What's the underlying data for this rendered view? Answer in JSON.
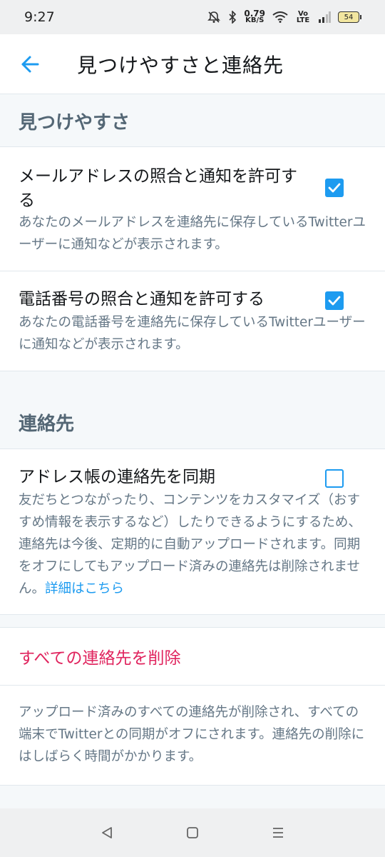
{
  "status_bar": {
    "time": "9:27",
    "net_speed_value": "0.79",
    "net_speed_unit": "KB/S",
    "network_label": "Vo LTE",
    "battery": "54",
    "icons": [
      "mute-icon",
      "bluetooth-icon",
      "wifi-icon",
      "signal-icon",
      "battery-icon"
    ]
  },
  "header": {
    "title": "見つけやすさと連絡先",
    "back_icon": "arrow-left-icon"
  },
  "discoverability": {
    "heading": "見つけやすさ",
    "email_row": {
      "title": "メールアドレスの照合と通知を許可する",
      "description": "あなたのメールアドレスを連絡先に保存しているTwitterユーザーに通知などが表示されます。",
      "checked": true
    },
    "phone_row": {
      "title": "電話番号の照合と通知を許可する",
      "description": "あなたの電話番号を連絡先に保存しているTwitterユーザーに通知などが表示されます。",
      "checked": true
    }
  },
  "contacts": {
    "heading": "連絡先",
    "sync_row": {
      "title": "アドレス帳の連絡先を同期",
      "description": "友だちとつながったり、コンテンツをカスタマイズ（おすすめ情報を表示するなど）したりできるようにするため、連絡先は今後、定期的に自動アップロードされます。同期をオフにしてもアップロード済みの連絡先は削除されません。",
      "link": "詳細はこちら",
      "checked": false
    },
    "delete_label": "すべての連絡先を削除",
    "delete_description": "アップロード済みのすべての連絡先が削除され、すべての端末でTwitterとの同期がオフにされます。連絡先の削除にはしばらく時間がかかります。"
  },
  "nav": {
    "back_icon": "triangle-back-icon",
    "home_icon": "square-home-icon",
    "menu_icon": "menu-lines-icon"
  },
  "colors": {
    "accent": "#1d9bf0",
    "danger": "#e0245e",
    "section_text": "#546775",
    "secondary_text": "#657786",
    "background": "#f5f8fa"
  }
}
